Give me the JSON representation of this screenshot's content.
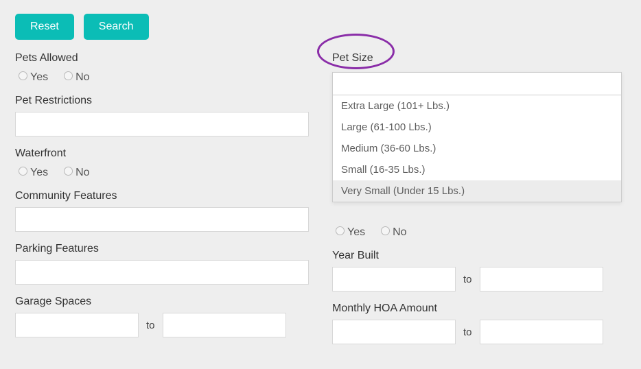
{
  "buttons": {
    "reset": "Reset",
    "search": "Search"
  },
  "left": {
    "pets_allowed": {
      "label": "Pets Allowed",
      "yes": "Yes",
      "no": "No"
    },
    "pet_restrictions": {
      "label": "Pet Restrictions",
      "value": ""
    },
    "waterfront": {
      "label": "Waterfront",
      "yes": "Yes",
      "no": "No"
    },
    "community_features": {
      "label": "Community Features",
      "value": ""
    },
    "parking_features": {
      "label": "Parking Features",
      "value": ""
    },
    "garage_spaces": {
      "label": "Garage Spaces",
      "from": "",
      "to_label": "to",
      "to": ""
    }
  },
  "right": {
    "pet_size": {
      "label": "Pet Size",
      "options": [
        "Extra Large (101+ Lbs.)",
        "Large (61-100 Lbs.)",
        "Medium (36-60 Lbs.)",
        "Small (16-35 Lbs.)",
        "Very Small (Under 15 Lbs.)"
      ],
      "highlighted_index": 4
    },
    "hidden_radio": {
      "yes": "Yes",
      "no": "No"
    },
    "year_built": {
      "label": "Year Built",
      "from": "",
      "to_label": "to",
      "to": ""
    },
    "monthly_hoa": {
      "label": "Monthly HOA Amount",
      "from": "",
      "to_label": "to",
      "to": ""
    }
  },
  "colors": {
    "accent": "#0bbdb6",
    "annotation": "#8a2da8"
  }
}
